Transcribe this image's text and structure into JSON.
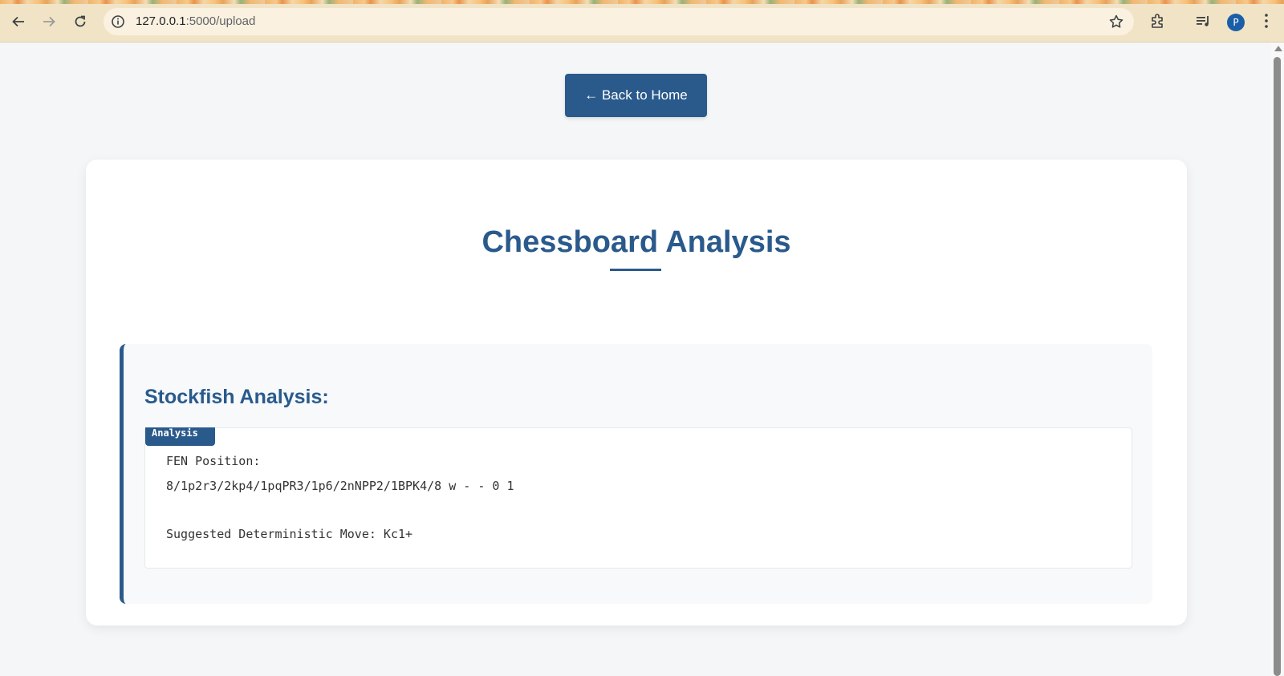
{
  "browser": {
    "url_host": "127.0.0.1",
    "url_path": ":5000/upload",
    "profile_initial": "P",
    "icons": {
      "back": "arrow-left-icon",
      "forward": "arrow-right-icon",
      "reload": "reload-icon",
      "site_info": "info-icon",
      "bookmark": "star-icon",
      "extensions": "puzzle-icon",
      "media": "media-queue-icon",
      "menu": "kebab-menu-icon"
    }
  },
  "page": {
    "back_button": "← Back to Home",
    "title": "Chessboard Analysis",
    "section_heading": "Stockfish Analysis:",
    "output_tag": "Analysis",
    "fen_label": "FEN Position:",
    "fen_value": "8/1p2r3/2kp4/1pqPR3/1p6/2nNPP2/1BPK4/8 w - - 0 1",
    "suggested_move": "Suggested Deterministic Move: Kc1+"
  },
  "colors": {
    "accent": "#2a5a8c",
    "page_background": "#f4f6f8",
    "card_background": "#ffffff",
    "chrome_background": "#f1e4c6"
  }
}
